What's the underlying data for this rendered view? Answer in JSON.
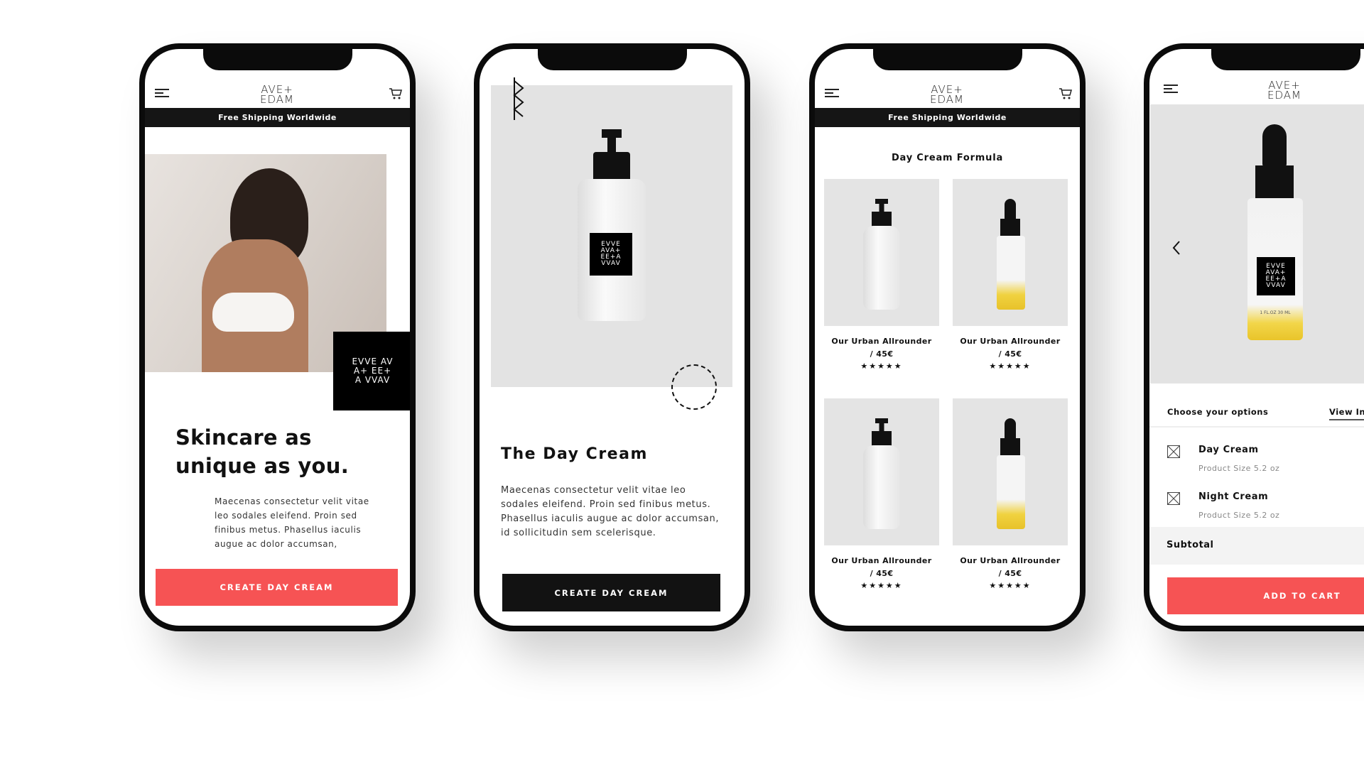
{
  "brand": {
    "logo_line1": "AVE+",
    "logo_line2": "EDAM",
    "tile_text": "EVVE AVA+ EE+A VVAV",
    "accent": "#f65354",
    "dark": "#121212"
  },
  "screen1": {
    "banner": "Free Shipping Worldwide",
    "headline_line1": "Skincare as",
    "headline_line2": "unique as you.",
    "body": "Maecenas consectetur velit vitae leo sodales eleifend. Proin sed finibus metus. Phasellus iaculis augue ac dolor accumsan,",
    "button": "CREATE DAY CREAM"
  },
  "screen2": {
    "title": "The Day Cream",
    "body": "Maecenas consectetur velit vitae leo sodales eleifend. Proin sed finibus metus. Phasellus iaculis augue ac dolor accumsan, id sollicitudin sem scelerisque.",
    "button": "CREATE DAY CREAM"
  },
  "screen3": {
    "banner": "Free Shipping Worldwide",
    "title": "Day Cream Formula",
    "products": [
      {
        "name": "Our Urban Allrounder",
        "price": "/ 45€",
        "rating": "★★★★★",
        "type": "pump"
      },
      {
        "name": "Our Urban Allrounder",
        "price": "/ 45€",
        "rating": "★★★★★",
        "type": "dropper"
      },
      {
        "name": "Our Urban Allrounder",
        "price": "/ 45€",
        "rating": "★★★★★",
        "type": "pump"
      },
      {
        "name": "Our Urban Allrounder",
        "price": "/ 45€",
        "rating": "★★★★★",
        "type": "dropper"
      }
    ]
  },
  "screen4": {
    "choose": "Choose your options",
    "view": "View Ingr",
    "options": [
      {
        "name": "Day Cream",
        "size": "Product Size 5.2 oz"
      },
      {
        "name": "Night Cream",
        "size": "Product Size 5.2 oz"
      }
    ],
    "subtotal": "Subtotal",
    "button": "ADD TO CART",
    "bottle_label": "1 FL.OZ 30 ML"
  }
}
